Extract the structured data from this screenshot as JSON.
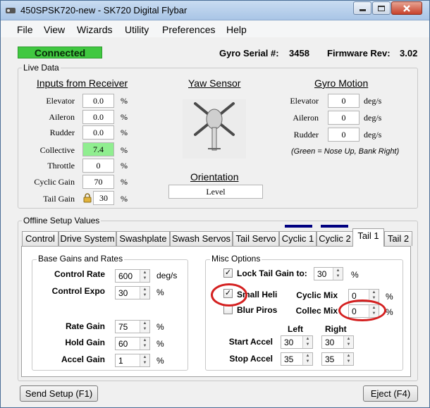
{
  "window": {
    "title": "450SPSK720-new - SK720 Digital Flybar"
  },
  "menu": [
    "File",
    "View",
    "Wizards",
    "Utility",
    "Preferences",
    "Help"
  ],
  "status": {
    "connection": "Connected",
    "serial_label": "Gyro Serial #:",
    "serial_value": "3458",
    "firmware_label": "Firmware Rev:",
    "firmware_value": "3.02"
  },
  "live_data": {
    "title": "Live Data",
    "inputs": {
      "title": "Inputs from Receiver",
      "rows": [
        {
          "label": "Elevator",
          "value": "0.0",
          "unit": "%"
        },
        {
          "label": "Aileron",
          "value": "0.0",
          "unit": "%"
        },
        {
          "label": "Rudder",
          "value": "0.0",
          "unit": "%"
        },
        {
          "label": "Collective",
          "value": "7.4",
          "unit": "%"
        },
        {
          "label": "Throttle",
          "value": "0",
          "unit": "%"
        },
        {
          "label": "Cyclic Gain",
          "value": "70",
          "unit": "%"
        },
        {
          "label": "Tail Gain",
          "value": "30",
          "unit": "%"
        }
      ]
    },
    "yaw": {
      "title": "Yaw Sensor",
      "orientation_title": "Orientation",
      "orientation_value": "Level"
    },
    "gyro_motion": {
      "title": "Gyro Motion",
      "rows": [
        {
          "label": "Elevator",
          "value": "0",
          "unit": "deg/s"
        },
        {
          "label": "Aileron",
          "value": "0",
          "unit": "deg/s"
        },
        {
          "label": "Rudder",
          "value": "0",
          "unit": "deg/s"
        }
      ],
      "note": "(Green = Nose Up, Bank Right)"
    }
  },
  "offline": {
    "title": "Offline Setup Values",
    "tabs": [
      "Control",
      "Drive System",
      "Swashplate",
      "Swash Servos",
      "Tail Servo",
      "Cyclic 1",
      "Cyclic 2",
      "Tail 1",
      "Tail 2"
    ],
    "active_tab": "Tail 1",
    "base_gains": {
      "title": "Base Gains and Rates",
      "control_rate": {
        "label": "Control Rate",
        "value": "600",
        "unit": "deg/s"
      },
      "control_expo": {
        "label": "Control Expo",
        "value": "30",
        "unit": "%"
      },
      "rate_gain": {
        "label": "Rate Gain",
        "value": "75",
        "unit": "%"
      },
      "hold_gain": {
        "label": "Hold Gain",
        "value": "60",
        "unit": "%"
      },
      "accel_gain": {
        "label": "Accel Gain",
        "value": "1",
        "unit": "%"
      }
    },
    "misc": {
      "title": "Misc Options",
      "lock_tail": {
        "label": "Lock Tail Gain to:",
        "checked": true,
        "value": "30",
        "unit": "%"
      },
      "small_heli": {
        "label": "Small Heli",
        "checked": true
      },
      "blur_piros": {
        "label": "Blur Piros",
        "checked": false
      },
      "cyclic_mix": {
        "label": "Cyclic Mix",
        "value": "0",
        "unit": "%"
      },
      "collec_mix": {
        "label": "Collec Mix",
        "value": "0",
        "unit": "%"
      },
      "left_label": "Left",
      "right_label": "Right",
      "start_accel": {
        "label": "Start Accel",
        "left": "30",
        "right": "30"
      },
      "stop_accel": {
        "label": "Stop Accel",
        "left": "35",
        "right": "35"
      }
    }
  },
  "buttons": {
    "send": "Send Setup (F1)",
    "eject": "Eject (F4)"
  },
  "colors": {
    "connected": "#40c840",
    "collective_highlight": "#90ee90",
    "annotation": "#d42020",
    "tab_marker": "#000080"
  }
}
